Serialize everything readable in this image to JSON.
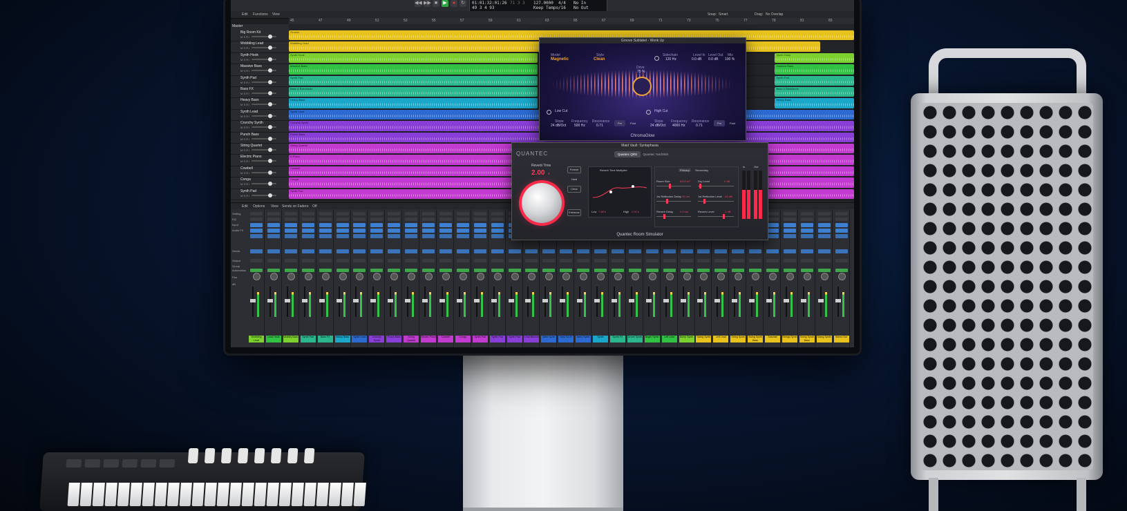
{
  "colors": {
    "yellow": "#e7c21d",
    "lime": "#7dd12e",
    "green": "#31c243",
    "teal": "#2bb78e",
    "cyan": "#1aa7c9",
    "blue": "#2c6ad1",
    "purple": "#8a3ed8",
    "magenta": "#c33ad0",
    "chroma_accent": "#f0a23a",
    "quantec_accent": "#ff3b5c"
  },
  "transport": {
    "position": "01:01:32:01:26",
    "bars": "49  3  4   93",
    "sub": "71  3  3",
    "tempo": "127.0000",
    "tempo_mode": "Keep Tempo",
    "signature": "4/4",
    "division": "/16",
    "in": "No In",
    "out": "No Out",
    "play_icon": "play-icon",
    "record_icon": "record-icon"
  },
  "toolbar": {
    "edit": "Edit",
    "functions": "Functions",
    "view": "View",
    "snap_label": "Snap:",
    "snap_value": "Smart",
    "drag_label": "Drag:",
    "drag_value": "No Overlap"
  },
  "ruler_marks": [
    "45",
    "47",
    "49",
    "51",
    "53",
    "55",
    "57",
    "59",
    "61",
    "63",
    "65",
    "67",
    "69",
    "71",
    "73",
    "75",
    "77",
    "79",
    "81",
    "83"
  ],
  "tracks_header": "Master",
  "tracks": [
    {
      "name": "Big Room Kit",
      "color": "yellow",
      "regions": [
        {
          "label": "Groove",
          "start": 0,
          "end": 1.0
        }
      ]
    },
    {
      "name": "Wobbling Lead",
      "color": "yellow",
      "regions": [
        {
          "label": "Wobbling Lead",
          "start": 0,
          "end": 0.94
        }
      ]
    },
    {
      "name": "Synth Hook",
      "color": "lime",
      "regions": [
        {
          "label": "Synth Hook",
          "start": 0,
          "end": 0.44
        },
        {
          "label": "Synth Hook",
          "start": 0.86,
          "end": 1.0
        }
      ]
    },
    {
      "name": "Massive Bass",
      "color": "green",
      "regions": [
        {
          "label": "Massive Bass",
          "start": 0,
          "end": 0.44
        },
        {
          "label": "Massive Bass",
          "start": 0.86,
          "end": 1.0
        }
      ]
    },
    {
      "name": "Synth Pad",
      "color": "teal",
      "regions": [
        {
          "label": "Synth Pad",
          "start": 0,
          "end": 0.44
        },
        {
          "label": "Synth Pad",
          "start": 0.86,
          "end": 1.0
        }
      ]
    },
    {
      "name": "Bass FX",
      "color": "teal",
      "regions": [
        {
          "label": "Bass & Basslands",
          "start": 0,
          "end": 0.44
        },
        {
          "label": "Bass & Basslands",
          "start": 0.86,
          "end": 1.0
        }
      ]
    },
    {
      "name": "Heavy Bass",
      "color": "cyan",
      "regions": [
        {
          "label": "Heavy Bass",
          "start": 0,
          "end": 0.44
        },
        {
          "label": "Heavy Bass",
          "start": 0.86,
          "end": 1.0
        }
      ]
    },
    {
      "name": "Synth Lead",
      "color": "blue",
      "regions": [
        {
          "label": "Synth Lead",
          "start": 0,
          "end": 1.0
        }
      ]
    },
    {
      "name": "Crunchy Synth",
      "color": "purple",
      "regions": [
        {
          "label": "Crunchy Synth",
          "start": 0,
          "end": 1.0
        }
      ]
    },
    {
      "name": "Punch Bass",
      "color": "purple",
      "regions": [
        {
          "label": "Punch Bass",
          "start": 0,
          "end": 1.0
        }
      ]
    },
    {
      "name": "String Quartet",
      "color": "magenta",
      "regions": [
        {
          "label": "String Quartet",
          "start": 0,
          "end": 1.0
        }
      ]
    },
    {
      "name": "Electric Piano",
      "color": "magenta",
      "regions": [
        {
          "label": "E.Piano",
          "start": 0,
          "end": 1.0
        }
      ]
    },
    {
      "name": "Cowbell",
      "color": "magenta",
      "regions": [
        {
          "label": "Cowbell",
          "start": 0,
          "end": 1.0
        }
      ]
    },
    {
      "name": "Conga",
      "color": "magenta",
      "regions": [
        {
          "label": "Conga",
          "start": 0,
          "end": 1.0
        }
      ]
    },
    {
      "name": "Synth Pad",
      "color": "magenta",
      "regions": [
        {
          "label": "Synth Pad",
          "start": 0,
          "end": 1.0
        }
      ]
    }
  ],
  "mixer_bar": {
    "edit": "Edit",
    "options": "Options",
    "view": "View",
    "sends_label": "Sends on Faders:",
    "sends_value": "Off"
  },
  "mixer_rows": [
    "Setting",
    "EQ",
    "Input",
    "Audio FX",
    "Sends",
    "Output",
    "Group",
    "Automation",
    "Pan",
    "dB"
  ],
  "mixer_channels": [
    {
      "name": "Wobbling Lead",
      "color": "lime"
    },
    {
      "name": "Lead Hook",
      "color": "green"
    },
    {
      "name": "Wobbly Bass",
      "color": "lime"
    },
    {
      "name": "Synth Pad",
      "color": "teal"
    },
    {
      "name": "Bass FX",
      "color": "teal"
    },
    {
      "name": "Heavy Bass",
      "color": "cyan"
    },
    {
      "name": "Synth Lead",
      "color": "blue"
    },
    {
      "name": "Crunchy Synth",
      "color": "purple"
    },
    {
      "name": "Punch Bass",
      "color": "purple"
    },
    {
      "name": "String Quartet",
      "color": "magenta"
    },
    {
      "name": "Electric Piano",
      "color": "magenta"
    },
    {
      "name": "Cowbell",
      "color": "magenta"
    },
    {
      "name": "Conga",
      "color": "magenta"
    },
    {
      "name": "Synth Pad",
      "color": "magenta"
    },
    {
      "name": "Synth Pad",
      "color": "purple"
    },
    {
      "name": "Synth Pad",
      "color": "purple"
    },
    {
      "name": "Lead Bounce",
      "color": "purple"
    },
    {
      "name": "Wide Synth",
      "color": "blue"
    },
    {
      "name": "Vinyl Sci-Fi",
      "color": "blue"
    },
    {
      "name": "Atmo Synth",
      "color": "blue"
    },
    {
      "name": "Synth",
      "color": "cyan"
    },
    {
      "name": "Synth FX",
      "color": "teal"
    },
    {
      "name": "Drone Synth",
      "color": "teal"
    },
    {
      "name": "Bright Synth",
      "color": "green"
    },
    {
      "name": "Left Lead",
      "color": "green"
    },
    {
      "name": "Bump Synth",
      "color": "lime"
    },
    {
      "name": "Swing Synth",
      "color": "yellow"
    },
    {
      "name": "Left Lead",
      "color": "yellow"
    },
    {
      "name": "String Synth",
      "color": "yellow"
    },
    {
      "name": "Swing Synth Bass",
      "color": "yellow"
    },
    {
      "name": "Saturate",
      "color": "yellow"
    },
    {
      "name": "Strings Synth",
      "color": "yellow"
    },
    {
      "name": "Swing Synth Bass",
      "color": "yellow"
    },
    {
      "name": "Swing Synth",
      "color": "yellow"
    },
    {
      "name": "Stereo Out",
      "color": "yellow"
    }
  ],
  "chromaglow": {
    "window_title": "Groove Sublabel - Wonk Up",
    "style_label": "Model",
    "style_value": "Magnetic",
    "style2_label": "Style",
    "style2_value": "Clean",
    "bypass_label": "Sidechain",
    "bypass_value": "120 Hz",
    "level_in_label": "Level In",
    "level_in_value": "0.0 dB",
    "level_out_label": "Level Out",
    "level_out_value": "0.0 dB",
    "mix_label": "Mix",
    "mix_value": "100 %",
    "drive_label": "Drive",
    "drive_value": "75 %",
    "low_cut": "Low Cut",
    "high_cut": "High Cut",
    "low_slope_label": "Slope",
    "low_slope_value": "24 dB/Oct",
    "low_freq_label": "Frequency",
    "low_freq_value": "500 Hz",
    "low_res_label": "Resonance",
    "low_res_value": "0.71",
    "high_slope_label": "Slope",
    "high_slope_value": "24 dB/Oct",
    "high_freq_label": "Frequency",
    "high_freq_value": "4000 Hz",
    "high_res_label": "Resonance",
    "high_res_value": "0.71",
    "btn_pre": "Pre",
    "btn_post": "Post",
    "btn_pre2": "Pre",
    "btn_post2": "Post",
    "product_name": "ChromaGlow"
  },
  "quantec": {
    "window_title": "Maid Vault: Syntaphasia",
    "logo": "QUANTEC",
    "tab_qrs": "Quantec QRS",
    "tab_yardstick": "Quantec YardStick",
    "reverb_time_label": "Reverb Time",
    "reverb_time_value": "2.00",
    "reverb_time_unit": "s",
    "freeze": "Freeze",
    "hold": "Hold",
    "clear": "Clear",
    "enhance": "Enhance",
    "graph_title": "Reverb Time Multiplier",
    "graph_low_label": "Low",
    "graph_low_value": "7.88 k",
    "graph_high_label": "High",
    "graph_high_value": "2.00 k",
    "sec_primary": "Primary",
    "sec_secondary": "Secondary",
    "room_size_label": "Room Size",
    "room_size_value": "8212 m³",
    "dry_level_label": "Dry Level",
    "dry_level_value": "0 dB",
    "first_ref_delay_label": "1st Reflection Delay",
    "first_ref_delay_value": "1.00 ms",
    "first_ref_level_label": "1st Reflection Level",
    "first_ref_level_value": "-15 dB",
    "reverb_delay_label": "Reverb Delay",
    "reverb_delay_value": "0.0 ms",
    "reverb_level_label": "Reverb Level",
    "reverb_level_value": "-1 dB",
    "meter_in": "In",
    "meter_out": "Out",
    "product_name": "Quantec Room Simulator"
  }
}
